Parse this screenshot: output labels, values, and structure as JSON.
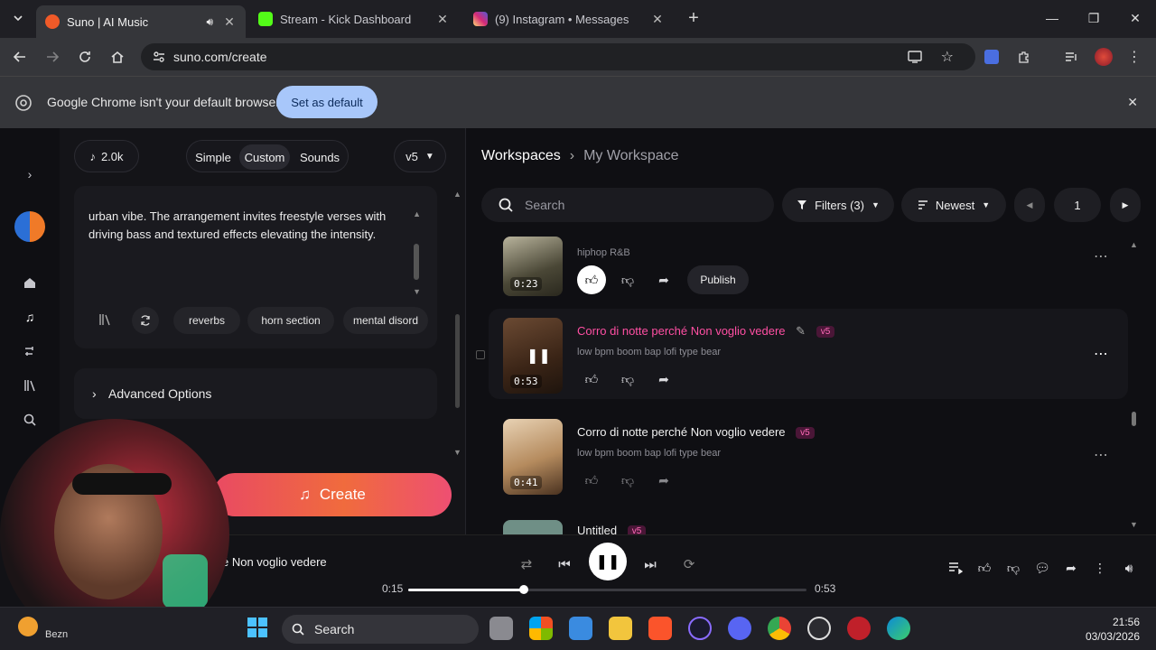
{
  "browser": {
    "tabs": [
      {
        "title": "Suno | AI Music",
        "favicon_color": "#f05a28"
      },
      {
        "title": "Stream - Kick Dashboard",
        "favicon_color": "#53fc18"
      },
      {
        "title": "(9) Instagram • Messages",
        "favicon_color": "#e1306c"
      }
    ],
    "new_tab_icon": "plus-icon",
    "url": "suno.com/create",
    "infobar": {
      "message": "Google Chrome isn't your default browser",
      "button": "Set as default"
    }
  },
  "create_panel": {
    "credits": "2.0k",
    "modes": [
      "Simple",
      "Custom",
      "Sounds"
    ],
    "active_mode": "Custom",
    "model": "v5",
    "lyrics_text": "urban vibe. The arrangement invites freestyle verses with driving bass and textured effects elevating the intensity.",
    "style_tags": [
      "reverbs",
      "horn section",
      "mental disord"
    ],
    "advanced_label": "Advanced Options",
    "create_label": "Create"
  },
  "workspace": {
    "breadcrumb_root": "Workspaces",
    "breadcrumb_current": "My Workspace",
    "search_placeholder": "Search",
    "filters_label": "Filters (3)",
    "sort_label": "Newest",
    "page": "1",
    "songs": [
      {
        "title": "",
        "desc": "hiphop R&B",
        "duration": "0:23",
        "publish": "Publish",
        "liked": true
      },
      {
        "title": "Corro di notte perché Non voglio vedere",
        "desc": "low bpm boom bap lofi type bear",
        "duration": "0:53",
        "version": "v5",
        "playing": true
      },
      {
        "title": "Corro di notte perché Non voglio vedere",
        "desc": "low bpm boom bap lofi type bear",
        "duration": "0:41",
        "version": "v5"
      },
      {
        "title": "Untitled",
        "version": "v5"
      }
    ]
  },
  "player": {
    "now_playing": "é Non voglio vedere",
    "elapsed": "0:15",
    "total": "0:53",
    "progress": 0.29
  },
  "taskbar": {
    "search": "Search",
    "time": "21:56",
    "date": "03/03/2026",
    "weather_label": "Bezn"
  }
}
